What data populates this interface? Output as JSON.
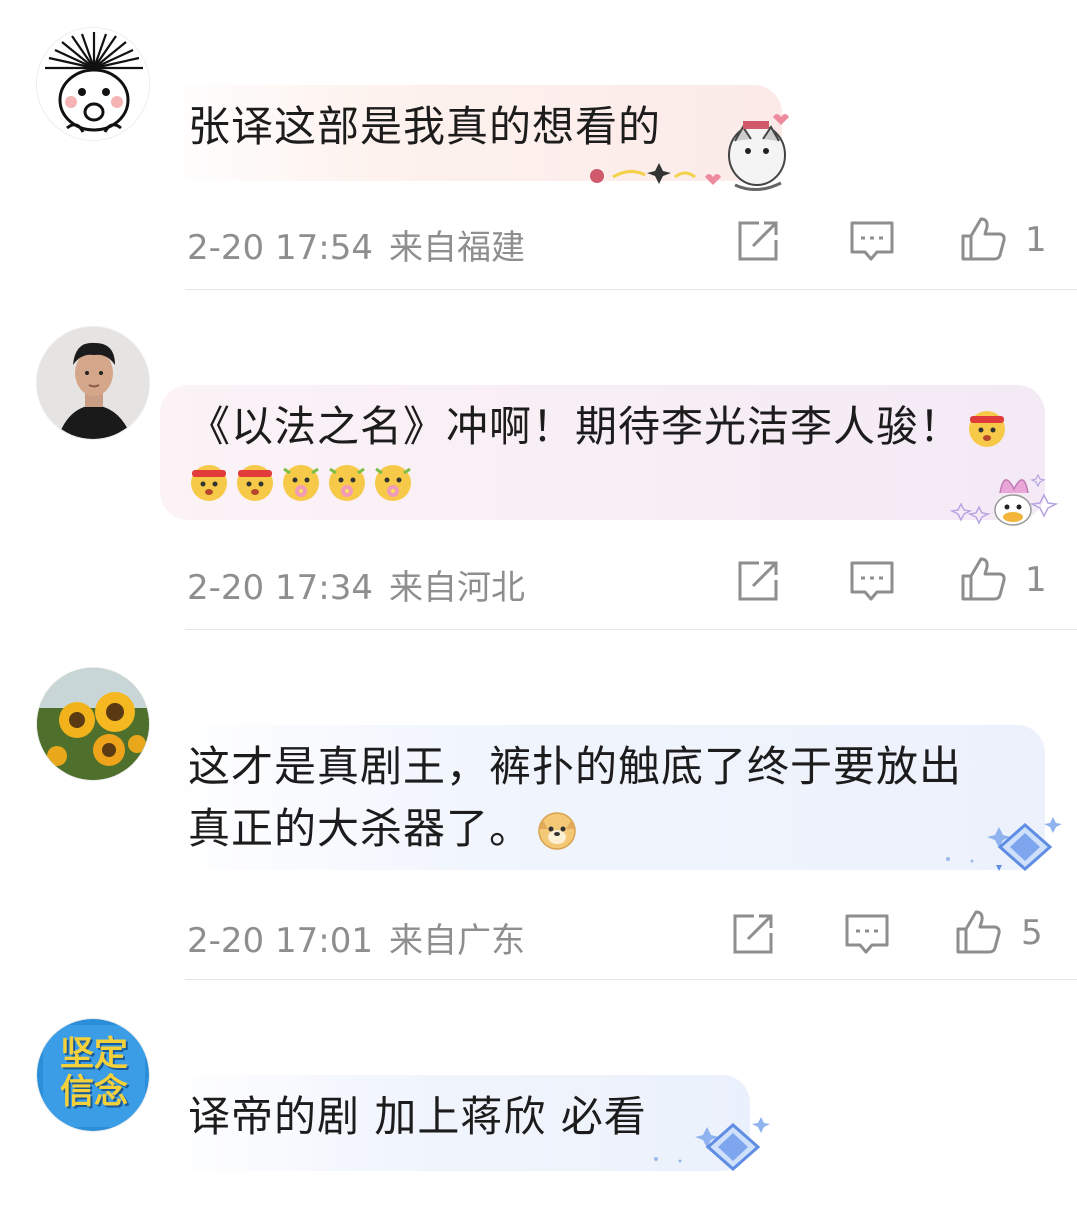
{
  "comments": [
    {
      "text": "张译这部是我真的想看的",
      "time": "2-20 17:54",
      "location": "来自福建",
      "likes": "1"
    },
    {
      "text_line1": "《以法之名》冲啊！期待李光洁李人骏！",
      "time": "2-20 17:34",
      "location": "来自河北",
      "likes": "1"
    },
    {
      "text_line1": "这才是真剧王，裤扑的触底了终于要放出",
      "text_line2": "真正的大杀器了。",
      "time": "2-20 17:01",
      "location": "来自广东",
      "likes": "5"
    },
    {
      "text": "译帝的剧 加上蒋欣 必看"
    }
  ],
  "avatar4_text": [
    "坚定",
    "信念"
  ],
  "icons": {
    "share": "share-square-icon",
    "reply": "comment-bubble-icon",
    "like": "thumbs-up-icon"
  },
  "colors": {
    "meta_gray": "#8e8e8e",
    "bubble_pink": "#fdf0ee",
    "bubble_lavender": "#f6eef6",
    "bubble_blue": "#eef3fd",
    "divider": "#e6e6e6"
  }
}
